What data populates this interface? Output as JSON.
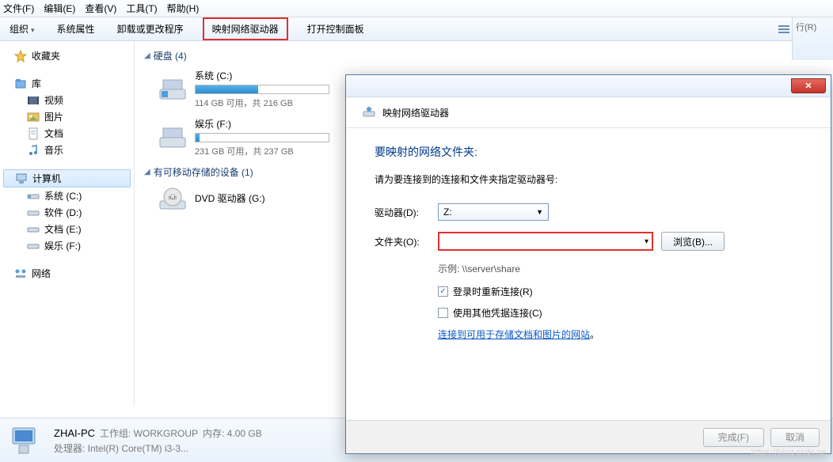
{
  "menu": {
    "file": "文件(F)",
    "edit": "编辑(E)",
    "view": "查看(V)",
    "tools": "工具(T)",
    "help": "帮助(H)"
  },
  "toolbar": {
    "organize": "组织",
    "sys_props": "系统属性",
    "uninstall": "卸载或更改程序",
    "map_drive": "映射网络驱动器",
    "open_cp": "打开控制面板"
  },
  "sidebar": {
    "favorites": "收藏夹",
    "libraries": "库",
    "videos": "视频",
    "pictures": "图片",
    "documents": "文档",
    "music": "音乐",
    "computer": "计算机",
    "system_c": "系统 (C:)",
    "software_d": "软件 (D:)",
    "documents_e": "文档 (E:)",
    "entertainment_f": "娱乐 (F:)",
    "network": "网络"
  },
  "content": {
    "hdd_header": "硬盘 (4)",
    "removable_header": "有可移动存储的设备 (1)",
    "drives": [
      {
        "name": "系统 (C:)",
        "stats": "114 GB 可用，共 216 GB",
        "fill": 47
      },
      {
        "name": "娱乐 (F:)",
        "stats": "231 GB 可用，共 237 GB",
        "fill": 3
      }
    ],
    "dvd": "DVD 驱动器 (G:)"
  },
  "status": {
    "pc_name": "ZHAI-PC",
    "workgroup_label": "工作组: WORKGROUP",
    "memory": "内存: 4.00 GB",
    "cpu": "处理器: Intel(R) Core(TM) i3-3..."
  },
  "dialog": {
    "header": "映射网络驱动器",
    "title": "要映射的网络文件夹:",
    "desc": "请为要连接到的连接和文件夹指定驱动器号:",
    "drive_label": "驱动器(D):",
    "drive_value": "Z:",
    "folder_label": "文件夹(O):",
    "browse": "浏览(B)...",
    "example": "示例: \\\\server\\share",
    "reconnect": "登录时重新连接(R)",
    "other_cred": "使用其他凭据连接(C)",
    "link_text": "连接到可用于存储文档和图片的网站",
    "link_dot": "。",
    "finish": "完成(F)",
    "cancel": "取消"
  },
  "right_edge": {
    "run": "行(R)"
  },
  "close_x": "✕",
  "check_mark": "✓",
  "watermark": "https://blog.csdn.ne"
}
